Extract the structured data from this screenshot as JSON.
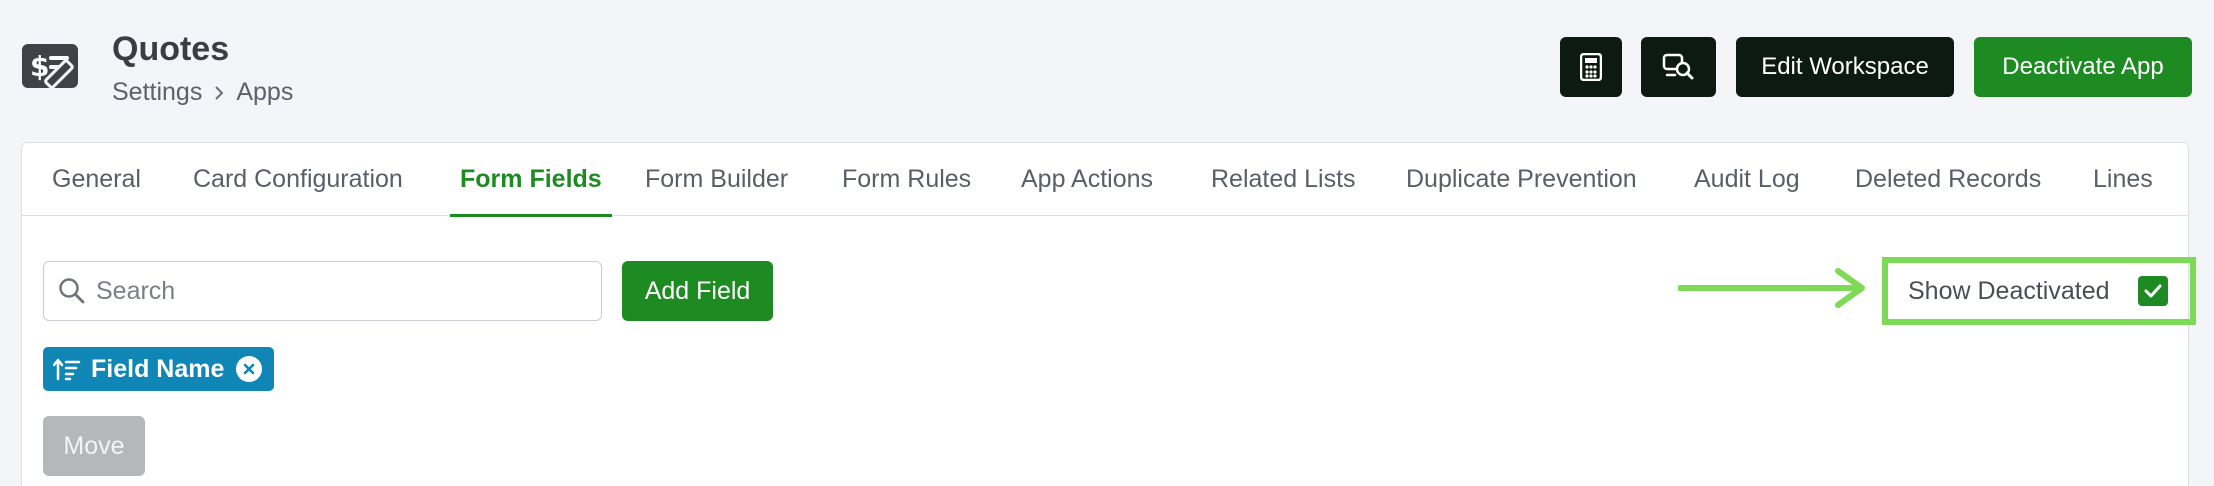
{
  "header": {
    "app_icon": "quote-pen-icon",
    "title": "Quotes",
    "breadcrumb": [
      "Settings",
      "Apps"
    ],
    "buttons": {
      "calculator_icon": "calculator-icon",
      "search_doc_icon": "search-document-icon",
      "edit_workspace": "Edit Workspace",
      "deactivate_app": "Deactivate App"
    }
  },
  "tabs": [
    {
      "label": "General",
      "active": false
    },
    {
      "label": "Card Configuration",
      "active": false
    },
    {
      "label": "Form Fields",
      "active": true
    },
    {
      "label": "Form Builder",
      "active": false
    },
    {
      "label": "Form Rules",
      "active": false
    },
    {
      "label": "App Actions",
      "active": false
    },
    {
      "label": "Related Lists",
      "active": false
    },
    {
      "label": "Duplicate Prevention",
      "active": false
    },
    {
      "label": "Audit Log",
      "active": false
    },
    {
      "label": "Deleted Records",
      "active": false
    },
    {
      "label": "Lines",
      "active": false
    }
  ],
  "toolbar": {
    "search_placeholder": "Search",
    "add_field": "Add Field",
    "show_deactivated": "Show Deactivated",
    "show_deactivated_checked": true
  },
  "sort_chip": {
    "label": "Field Name"
  },
  "move_button": "Move",
  "colors": {
    "brand_green": "#1e8a22",
    "dark": "#0c1a12",
    "chip_blue": "#0f86b6",
    "highlight": "#7ed957"
  }
}
